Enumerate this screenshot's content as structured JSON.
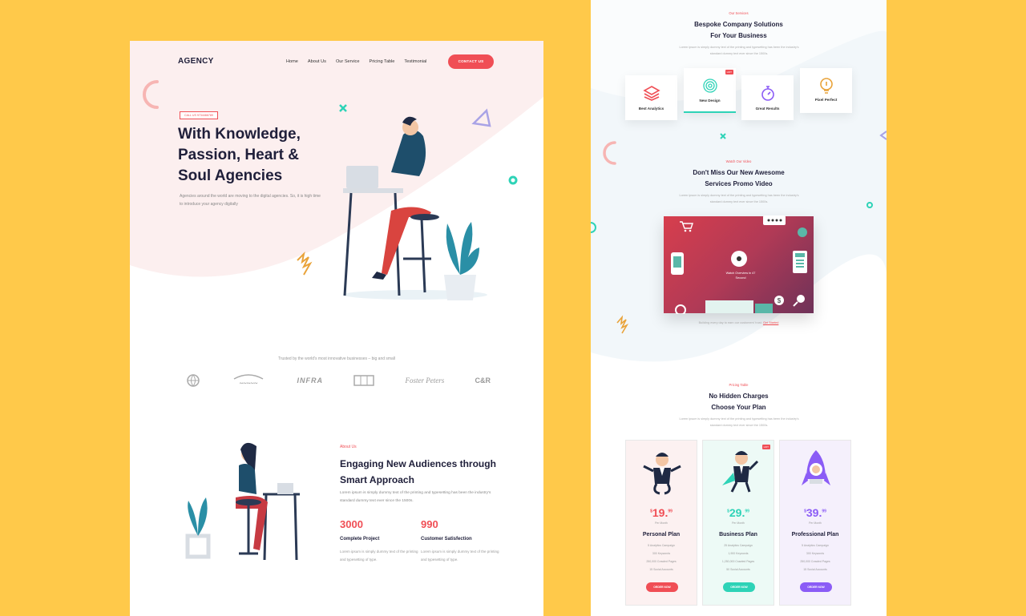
{
  "colors": {
    "background": "#FFC94A",
    "accent": "#F04E55",
    "teal": "#2ED3B7",
    "purple": "#8B5CF6",
    "navy": "#1F1F3A"
  },
  "left": {
    "logo": "AGENCY",
    "nav": [
      "Home",
      "About Us",
      "Our Service",
      "Pricing Table",
      "Testimonial"
    ],
    "contact_button": "CONTACT US",
    "badge": "CALL US 9734466789",
    "hero_title": "With Knowledge, Passion, Heart & Soul Agencies",
    "hero_subtitle": "Agencies around the world are moving to the digital agencies. So, it is high time to introduce your agency digitally",
    "trusted_text": "Trusted by the world's most innovative businesses – big and small",
    "brands": [
      "INFRA",
      "Foster Peters",
      "C&R"
    ],
    "about": {
      "tag": "About Us",
      "title": "Engaging New Audiences through Smart Approach",
      "text": "Lorem ipsum is simply dummy text of the printing and typesetting has been the industry's standard dummy text ever since the 1500s.",
      "stats": [
        {
          "number": "3000",
          "label": "Complete Project",
          "text": "Lorem ipsum is simply dummy text of the printing and typesetting of type."
        },
        {
          "number": "990",
          "label": "Customer Satisfection",
          "text": "Lorem ipsum is simply dummy text of the printing and typesetting of type."
        }
      ]
    }
  },
  "right": {
    "services": {
      "tag": "Our Services",
      "title_line1": "Bespoke Company Solutions",
      "title_line2": "For Your Business",
      "text": "Lorem ipsum is simply dummy text of the printing and typesetting has been the industry's standard dummy text ever since the 1500s.",
      "cards": [
        {
          "label": "Best Analytics",
          "icon": "layers-icon"
        },
        {
          "label": "New Design",
          "icon": "fingerprint-icon",
          "badge": "HOT"
        },
        {
          "label": "Great Results",
          "icon": "stopwatch-icon"
        },
        {
          "label": "Pixel Perfect",
          "icon": "lightbulb-icon"
        }
      ]
    },
    "video": {
      "tag": "Watch Our Video",
      "title_line1": "Don't Miss Our New Awesome",
      "title_line2": "Services Promo Video",
      "text": "Lorem ipsum is simply dummy text of the printing and typesetting has been the industry's standard dummy text ever since the 1500s.",
      "caption": "Watch Overview in 47 Second",
      "note": "Building every day to earn our customers' trust.",
      "note_link": "Get Started"
    },
    "pricing": {
      "tag": "Pricing Table",
      "title_line1": "No Hidden Charges",
      "title_line2": "Choose Your Plan",
      "text": "Lorem ipsum is simply dummy text of the printing and typesetting has been the industry's standard dummy text ever since the 1500s.",
      "plans": [
        {
          "currency": "$",
          "price": "19",
          "cents": "99",
          "per": "Per Month",
          "name": "Personal Plan",
          "features": [
            "5 Analytics Campaign",
            "300 Keywords",
            "250,000 Crawled Pages",
            "15 Social Accounts"
          ],
          "button": "ORDER NOW",
          "color": "#F04E55",
          "bg": "#FCF1F1"
        },
        {
          "currency": "$",
          "price": "29",
          "cents": "99",
          "per": "Per Month",
          "name": "Business Plan",
          "features": [
            "25 Analytics Campaign",
            "1,900 Keywords",
            "1,250,000 Crawled Pages",
            "50 Social Accounts"
          ],
          "button": "ORDER NOW",
          "color": "#2ED3B7",
          "bg": "#EDFAF6",
          "badge": "HOT"
        },
        {
          "currency": "$",
          "price": "39",
          "cents": "99",
          "per": "Per Month",
          "name": "Professional Plan",
          "features": [
            "5 Analytics Campaign",
            "300 Keywords",
            "250,000 Crawled Pages",
            "15 Social Accounts"
          ],
          "button": "ORDER NOW",
          "color": "#8B5CF6",
          "bg": "#F5F0FC"
        }
      ]
    }
  }
}
